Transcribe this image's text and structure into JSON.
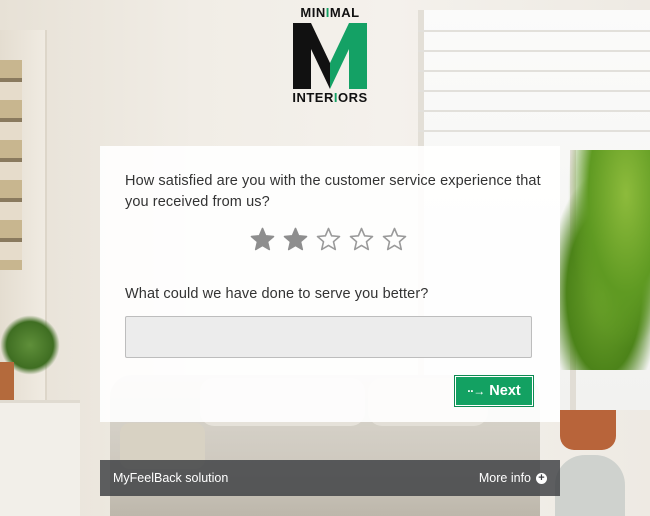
{
  "brand": {
    "logo_top_prefix": "MIN",
    "logo_top_accent": "I",
    "logo_top_suffix": "MAL",
    "logo_bottom_prefix": "INTER",
    "logo_bottom_accent": "I",
    "logo_bottom_suffix": "ORS",
    "logo_letter": "M",
    "colors": {
      "black": "#111111",
      "green": "#14a165"
    }
  },
  "survey": {
    "question1": "How satisfied are you with the customer service experience that you received from us?",
    "rating": {
      "value": 2,
      "max": 5,
      "filled_color": "#8e8e8e",
      "empty_color": "#9a9a9a"
    },
    "question2": "What could we have done to serve you better?",
    "answer": {
      "value": "",
      "placeholder": ""
    },
    "next_label": "Next",
    "next_icon": "arrow-right-icon",
    "accent": "#13a162"
  },
  "footer": {
    "brand_text": "MyFeelBack solution",
    "more_info_label": "More info",
    "more_info_icon": "plus-circle-icon"
  }
}
